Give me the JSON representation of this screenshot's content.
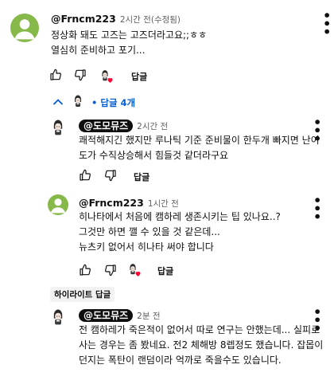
{
  "comments": {
    "top": {
      "handle": "@Frncm223",
      "time": "2시간 전(수정됨)",
      "text": "정상화 돼도 고즈는 고즈더라고요;;ㅎㅎ\n열심히 준비하고 포기...",
      "reply_label": "답글"
    },
    "replies_toggle": {
      "label": "답글 4개"
    },
    "reply1": {
      "handle": "@도모뮤즈",
      "time": "2시간 전",
      "text": "쾌적해지긴 했지만 루나틱 기준 준비물이 한두개 빠지면 난이\n도가 수직상승해서 힘들것 같더라구요",
      "reply_label": "답글"
    },
    "reply2": {
      "handle": "@Frncm223",
      "time": "1시간 전",
      "text": "히나타에서 처음에 캠하레 생존시키는 팁 있나요..?\n그것만 하면 깰 수 있을 것 같은데...\n뉴츠키 없어서 히나타 써야 합니다",
      "reply_label": "답글"
    },
    "highlight": {
      "tag": "하이라이트 답글",
      "handle": "@도모뮤즈",
      "time": "2분 전",
      "text": "전 캠하레가 죽은적이 없어서 따로 연구는 안했는데... 실피로\n사는 경우는 좀 봤네요. 전2 체해방 8렙정도 했습니다. 잡몹이\n던지는 폭탄이 랜덤이라 억까로 죽을수도 있습니다."
    }
  },
  "icons": {
    "like": "thumb-up-icon",
    "dislike": "thumb-down-icon",
    "heart": "creator-heart-icon",
    "more": "more-vert-icon",
    "expand": "chevron-up-icon"
  },
  "colors": {
    "accent": "#065fd4",
    "heart": "#ff0033",
    "avatar_green": "#86b84a",
    "badge_bg": "#0f0f0f",
    "highlight_bg": "#f2f2f2"
  }
}
